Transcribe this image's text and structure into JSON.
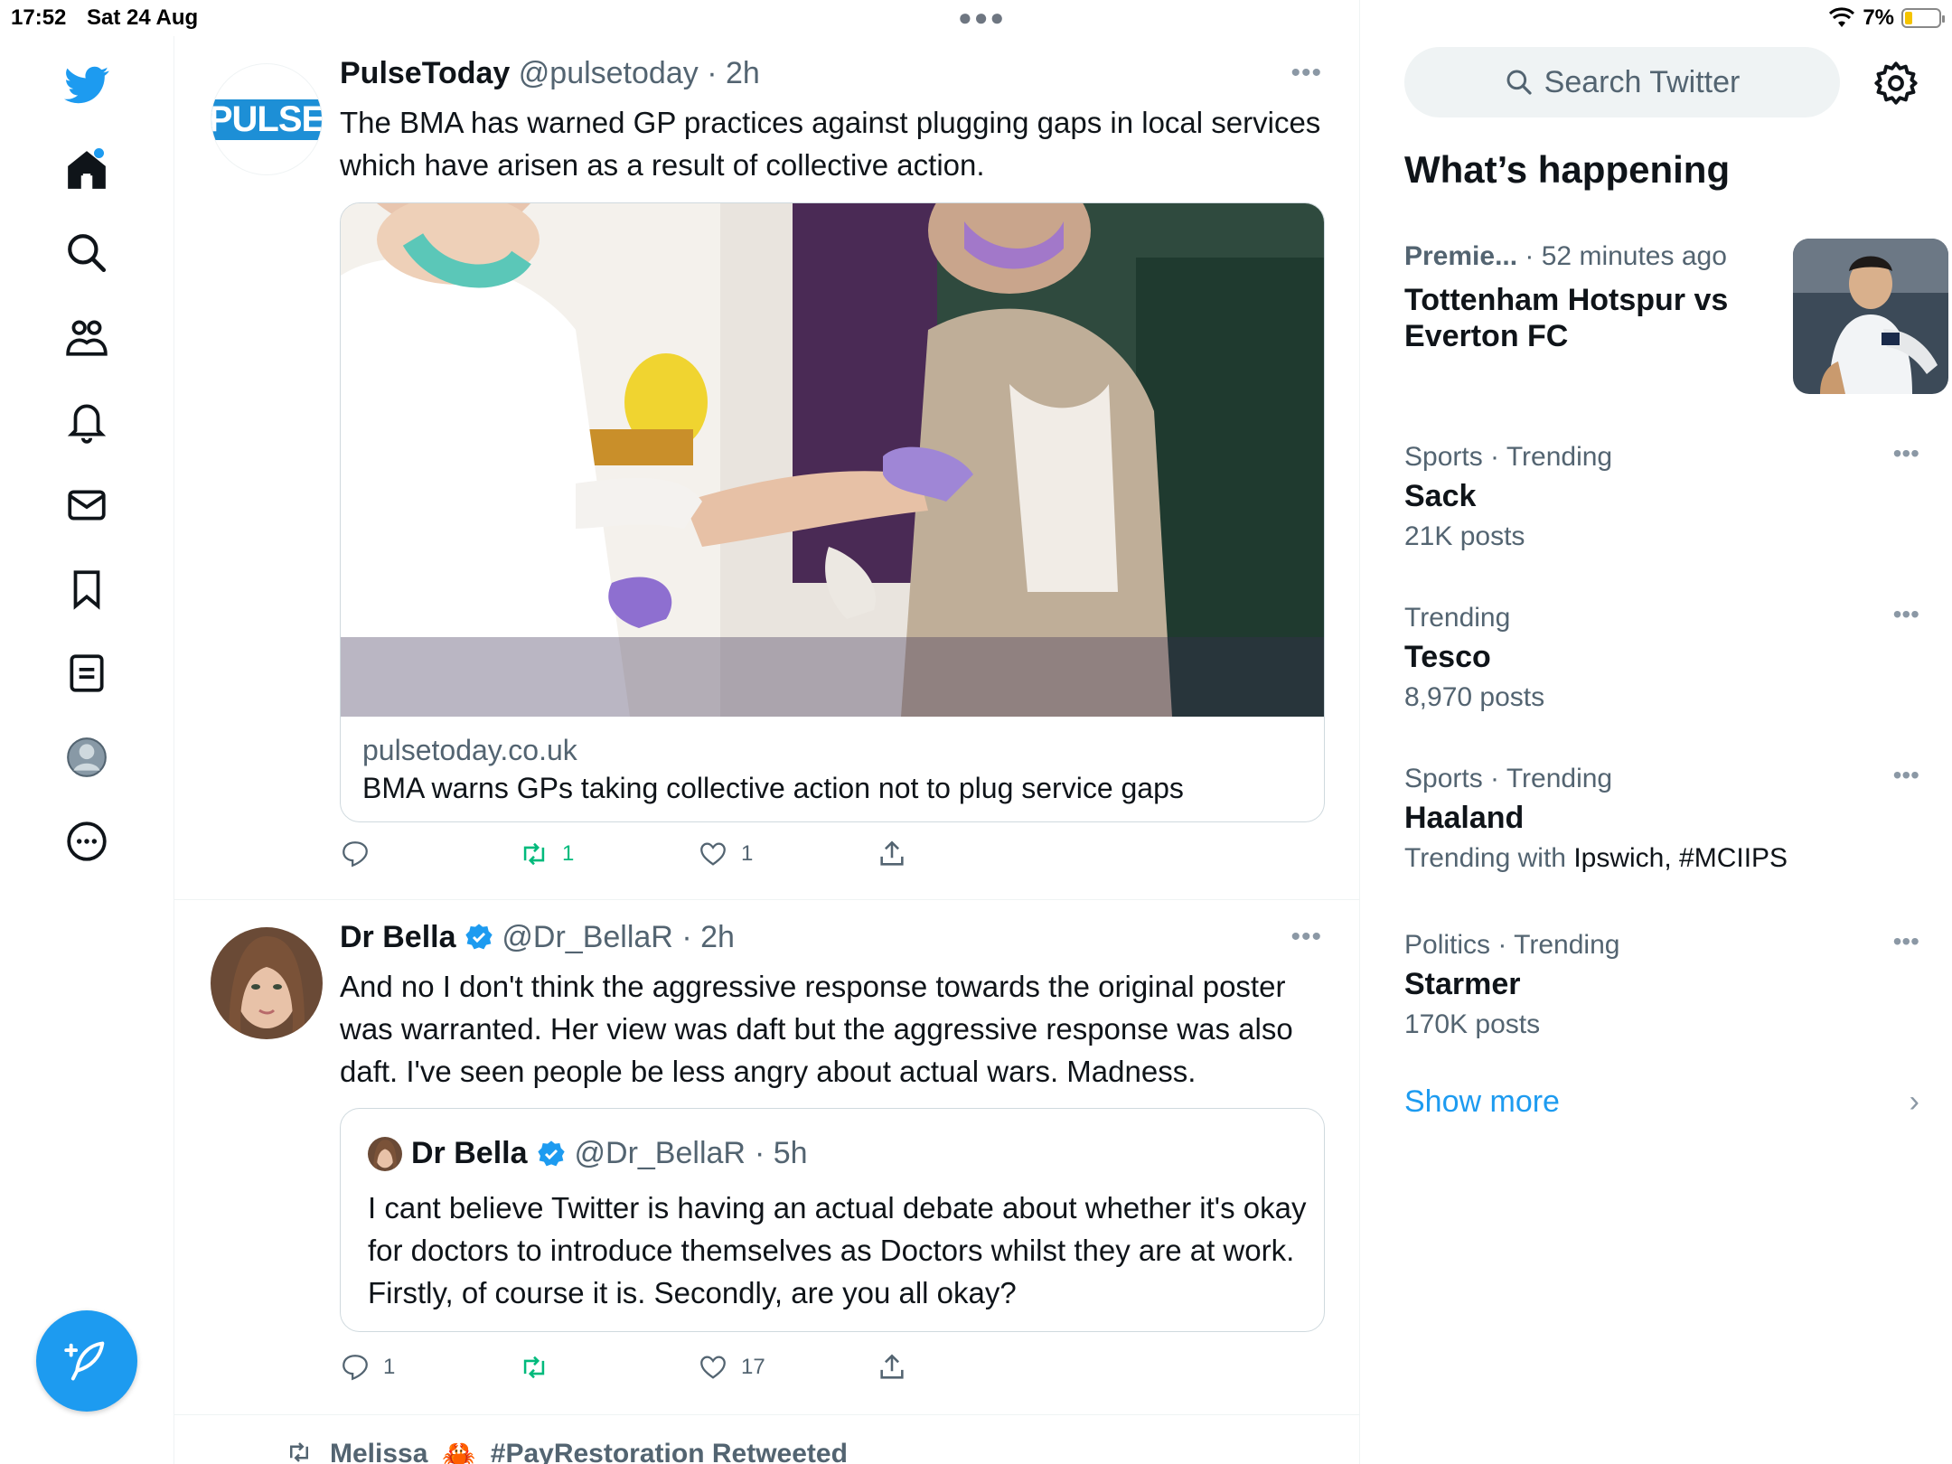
{
  "status_bar": {
    "time": "17:52",
    "date": "Sat 24 Aug",
    "battery": "7%"
  },
  "tweets": [
    {
      "name": "PulseToday",
      "handle": "@pulsetoday",
      "time": "· 2h",
      "avatar_text": "PULSE",
      "text": "The BMA has warned GP practices against plugging gaps in local services which have arisen as a result of collective action.",
      "card": {
        "domain": "pulsetoday.co.uk",
        "title": "BMA warns GPs taking collective action not to plug service gaps"
      },
      "stats": {
        "replies": "",
        "retweets": "1",
        "likes": "1"
      }
    },
    {
      "name": "Dr Bella",
      "handle": "@Dr_BellaR",
      "time": "· 2h",
      "text": "And no I don't think the aggressive response towards the original poster was warranted. Her view was daft but the aggressive response was also daft. I've seen people be less angry about actual wars. Madness.",
      "quote": {
        "name": "Dr Bella",
        "handle": "@Dr_BellaR",
        "time": "· 5h",
        "text": "I cant believe Twitter is having an actual debate about whether it's okay for doctors to introduce themselves as Doctors whilst they are at work.  Firstly, of course it is. Secondly, are you all okay?"
      },
      "stats": {
        "replies": "1",
        "retweets": "",
        "likes": "17"
      }
    }
  ],
  "retweeted_by": {
    "name": "Melissa",
    "emoji": "🦀",
    "text": "#PayRestoration Retweeted"
  },
  "sidebar": {
    "search_placeholder": "Search Twitter",
    "whats_happening": "What’s happening",
    "featured": {
      "category": "Premie...",
      "time": "· 52 minutes ago",
      "title": "Tottenham Hotspur vs Everton FC"
    },
    "trends": [
      {
        "meta": "Sports · Trending",
        "name": "Sack",
        "sub": "21K posts"
      },
      {
        "meta": "Trending",
        "name": "Tesco",
        "sub": "8,970 posts"
      },
      {
        "meta": "Sports · Trending",
        "name": "Haaland",
        "sub_prefix": "Trending with",
        "sub_dark": "Ipswich, #MCIIPS"
      },
      {
        "meta": "Politics · Trending",
        "name": "Starmer",
        "sub": "170K posts"
      }
    ],
    "show_more": "Show more"
  },
  "colors": {
    "accent": "#1d9bf0",
    "retweet": "#00ba7c",
    "muted": "#536471",
    "text": "#0f1419",
    "border": "#eff3f4"
  }
}
